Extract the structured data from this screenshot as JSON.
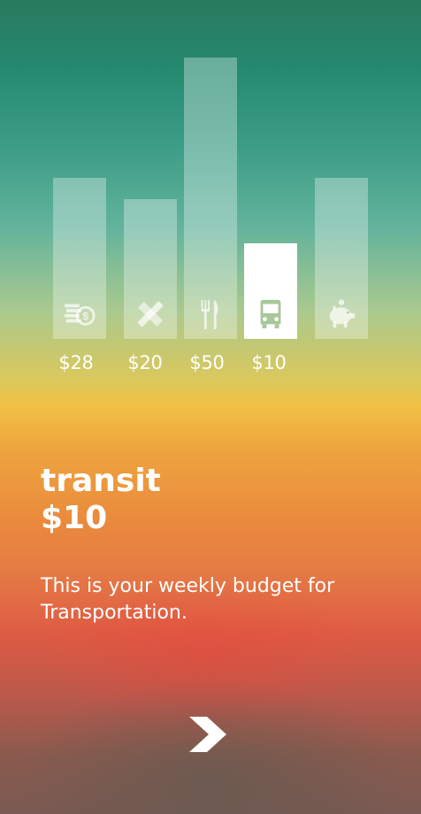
{
  "bars": [
    {
      "icon": "coins-icon",
      "amount": "$28"
    },
    {
      "icon": "pencil-ruler-icon",
      "amount": "$20"
    },
    {
      "icon": "fork-knife-icon",
      "amount": "$50"
    },
    {
      "icon": "bus-icon",
      "amount": "$10",
      "active": true
    },
    {
      "icon": "piggy-bank-icon",
      "amount": ""
    }
  ],
  "detail": {
    "category": "transit",
    "price": "$10",
    "description": "This is your weekly budget for Transportation."
  },
  "colors": {
    "bar": "#ffffff",
    "text": "#ffffff"
  },
  "next_icon": "chevron-right-icon"
}
